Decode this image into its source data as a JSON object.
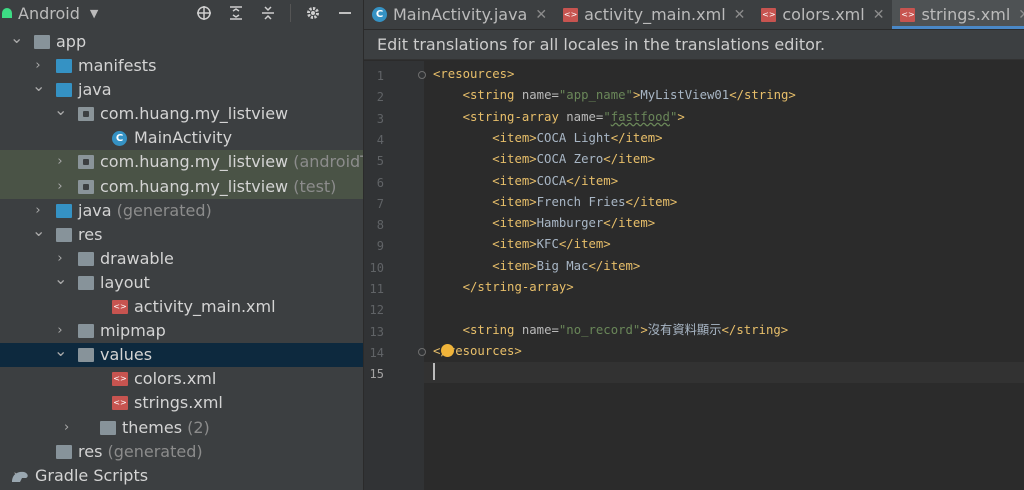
{
  "project": {
    "view_name": "Android",
    "tree": [
      {
        "label": "app",
        "hint": "",
        "indent": 0,
        "arrow": "down",
        "icon": "folder"
      },
      {
        "label": "manifests",
        "hint": "",
        "indent": 1,
        "arrow": "right",
        "icon": "folder-blue"
      },
      {
        "label": "java",
        "hint": "",
        "indent": 1,
        "arrow": "down",
        "icon": "folder-blue"
      },
      {
        "label": "com.huang.my_listview",
        "hint": "",
        "indent": 2,
        "arrow": "down",
        "icon": "package"
      },
      {
        "label": "MainActivity",
        "hint": "",
        "indent": 3,
        "arrow": "",
        "icon": "class"
      },
      {
        "label": "com.huang.my_listview",
        "hint": "(androidTest)",
        "indent": 2,
        "arrow": "right",
        "icon": "package",
        "highlight": true
      },
      {
        "label": "com.huang.my_listview",
        "hint": "(test)",
        "indent": 2,
        "arrow": "right",
        "icon": "package",
        "highlight": true
      },
      {
        "label": "java",
        "hint": "(generated)",
        "indent": 1,
        "arrow": "right",
        "icon": "folder-gen"
      },
      {
        "label": "res",
        "hint": "",
        "indent": 1,
        "arrow": "down",
        "icon": "folder-res"
      },
      {
        "label": "drawable",
        "hint": "",
        "indent": 2,
        "arrow": "right",
        "icon": "folder"
      },
      {
        "label": "layout",
        "hint": "",
        "indent": 2,
        "arrow": "down",
        "icon": "folder"
      },
      {
        "label": "activity_main.xml",
        "hint": "",
        "indent": 3,
        "arrow": "",
        "icon": "xml"
      },
      {
        "label": "mipmap",
        "hint": "",
        "indent": 2,
        "arrow": "right",
        "icon": "folder"
      },
      {
        "label": "values",
        "hint": "",
        "indent": 2,
        "arrow": "down",
        "icon": "folder",
        "selected": true
      },
      {
        "label": "colors.xml",
        "hint": "",
        "indent": 3,
        "arrow": "",
        "icon": "xml"
      },
      {
        "label": "strings.xml",
        "hint": "",
        "indent": 3,
        "arrow": "",
        "icon": "xml"
      },
      {
        "label": "themes",
        "hint": "(2)",
        "indent": 3,
        "arrow": "right",
        "icon": "folder",
        "arrowIndent": 2.3
      },
      {
        "label": "res",
        "hint": "(generated)",
        "indent": 1,
        "arrow": "",
        "icon": "folder-res"
      },
      {
        "label": "Gradle Scripts",
        "hint": "",
        "indent": 0,
        "arrow": "right",
        "icon": "gradle"
      }
    ]
  },
  "tabs": [
    {
      "label": "MainActivity.java",
      "icon": "class",
      "active": false
    },
    {
      "label": "activity_main.xml",
      "icon": "xml",
      "active": false
    },
    {
      "label": "colors.xml",
      "icon": "xml",
      "active": false
    },
    {
      "label": "strings.xml",
      "icon": "xml",
      "active": true
    }
  ],
  "banner": "Edit translations for all locales in the translations editor.",
  "editor": {
    "current_line": 15,
    "lines": [
      [
        [
          "tag",
          "<resources>"
        ]
      ],
      [
        [
          "sp",
          "    "
        ],
        [
          "tag",
          "<string "
        ],
        [
          "attr",
          "name="
        ],
        [
          "val",
          "\"app_name\""
        ],
        [
          "tag",
          ">"
        ],
        [
          "txt",
          "MyListView01"
        ],
        [
          "tag",
          "</string>"
        ]
      ],
      [
        [
          "sp",
          "    "
        ],
        [
          "tag",
          "<string-array "
        ],
        [
          "attr",
          "name="
        ],
        [
          "val",
          "\""
        ],
        [
          "valw",
          "fastfood"
        ],
        [
          "val",
          "\""
        ],
        [
          "tag",
          ">"
        ]
      ],
      [
        [
          "sp",
          "        "
        ],
        [
          "tag",
          "<item>"
        ],
        [
          "txt",
          "COCA Light"
        ],
        [
          "tag",
          "</item>"
        ]
      ],
      [
        [
          "sp",
          "        "
        ],
        [
          "tag",
          "<item>"
        ],
        [
          "txt",
          "COCA Zero"
        ],
        [
          "tag",
          "</item>"
        ]
      ],
      [
        [
          "sp",
          "        "
        ],
        [
          "tag",
          "<item>"
        ],
        [
          "txt",
          "COCA"
        ],
        [
          "tag",
          "</item>"
        ]
      ],
      [
        [
          "sp",
          "        "
        ],
        [
          "tag",
          "<item>"
        ],
        [
          "txt",
          "French Fries"
        ],
        [
          "tag",
          "</item>"
        ]
      ],
      [
        [
          "sp",
          "        "
        ],
        [
          "tag",
          "<item>"
        ],
        [
          "txt",
          "Hamburger"
        ],
        [
          "tag",
          "</item>"
        ]
      ],
      [
        [
          "sp",
          "        "
        ],
        [
          "tag",
          "<item>"
        ],
        [
          "txt",
          "KFC"
        ],
        [
          "tag",
          "</item>"
        ]
      ],
      [
        [
          "sp",
          "        "
        ],
        [
          "tag",
          "<item>"
        ],
        [
          "txt",
          "Big Mac"
        ],
        [
          "tag",
          "</item>"
        ]
      ],
      [
        [
          "sp",
          "    "
        ],
        [
          "tag",
          "</string-array>"
        ]
      ],
      [],
      [
        [
          "sp",
          "    "
        ],
        [
          "tag",
          "<string "
        ],
        [
          "attr",
          "name="
        ],
        [
          "val",
          "\"no_record\""
        ],
        [
          "tag",
          ">"
        ],
        [
          "txt",
          "沒有資料顯示"
        ],
        [
          "tag",
          "</string>"
        ]
      ],
      [
        [
          "tag",
          "</resources>"
        ]
      ],
      []
    ]
  },
  "colors": {
    "tag": "#e8bf6a",
    "attr": "#bababa",
    "value": "#6a8759",
    "text": "#a9b7c6",
    "selection": "#0d293e",
    "accent": "#4a88c7"
  }
}
